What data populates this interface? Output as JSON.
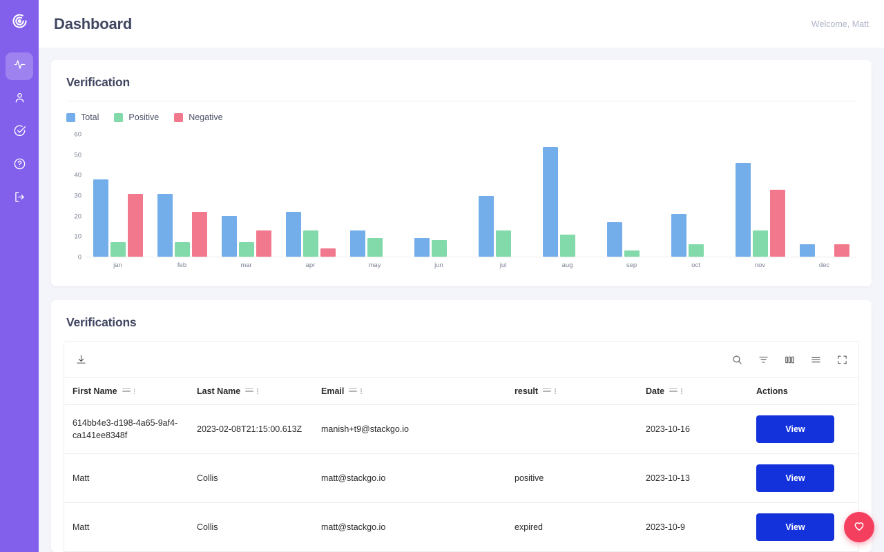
{
  "brand": {
    "logo_icon": "spiral-logo-icon",
    "sidebar_color": "#8260ec"
  },
  "sidebar": {
    "items": [
      {
        "icon": "activity-pulse-icon",
        "name": "activity",
        "active": true
      },
      {
        "icon": "user-icon",
        "name": "users",
        "active": false
      },
      {
        "icon": "check-circle-icon",
        "name": "verifications",
        "active": false
      },
      {
        "icon": "help-circle-icon",
        "name": "help",
        "active": false
      },
      {
        "icon": "logout-icon",
        "name": "logout",
        "active": false
      }
    ]
  },
  "header": {
    "title": "Dashboard",
    "welcome": "Welcome, Matt"
  },
  "verification_card": {
    "title": "Verification"
  },
  "verifications_card": {
    "title": "Verifications"
  },
  "toolbar": {
    "download_icon": "download-icon",
    "icons": [
      "search-icon",
      "filter-icon",
      "columns-icon",
      "density-icon",
      "fullscreen-icon"
    ]
  },
  "table": {
    "columns": [
      "First Name",
      "Last Name",
      "Email",
      "result",
      "Date",
      "Actions"
    ],
    "action_label": "View",
    "rows": [
      {
        "first_name": "614bb4e3-d198-4a65-9af4-ca141ee8348f",
        "last_name": "2023-02-08T21:15:00.613Z",
        "email": "manish+t9@stackgo.io",
        "result": "",
        "date": "2023-10-16"
      },
      {
        "first_name": "Matt",
        "last_name": "Collis",
        "email": "matt@stackgo.io",
        "result": "positive",
        "date": "2023-10-13"
      },
      {
        "first_name": "Matt",
        "last_name": "Collis",
        "email": "matt@stackgo.io",
        "result": "expired",
        "date": "2023-10-9"
      }
    ]
  },
  "fab": {
    "icon": "heart-icon",
    "color": "#f43f5e"
  },
  "chart_data": {
    "type": "bar",
    "title": "Verification",
    "xlabel": "",
    "ylabel": "",
    "ylim": [
      0,
      60
    ],
    "yticks": [
      0,
      10,
      20,
      30,
      40,
      50,
      60
    ],
    "grid": false,
    "legend_position": "top-left",
    "categories": [
      "jan",
      "feb",
      "mar",
      "apr",
      "may",
      "jun",
      "jul",
      "aug",
      "sep",
      "oct",
      "nov",
      "dec"
    ],
    "series": [
      {
        "name": "Total",
        "color": "#74aeea",
        "values": [
          38,
          31,
          20,
          22,
          13,
          9,
          30,
          54,
          17,
          21,
          46,
          6
        ]
      },
      {
        "name": "Positive",
        "color": "#82d9a9",
        "values": [
          7,
          7,
          7,
          13,
          9,
          8,
          13,
          11,
          3,
          6,
          13,
          0
        ]
      },
      {
        "name": "Negative",
        "color": "#f2798d",
        "values": [
          31,
          22,
          13,
          4,
          0,
          0,
          0,
          0,
          0,
          0,
          33,
          6
        ]
      }
    ]
  }
}
